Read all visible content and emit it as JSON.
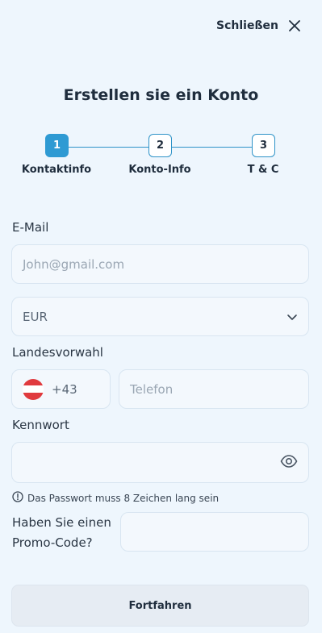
{
  "header": {
    "close_label": "Schließen"
  },
  "title": "Erstellen sie ein Konto",
  "stepper": {
    "steps": [
      {
        "number": "1",
        "label": "Kontaktinfo",
        "active": true
      },
      {
        "number": "2",
        "label": "Konto-Info",
        "active": false
      },
      {
        "number": "3",
        "label": "T & C",
        "active": false
      }
    ]
  },
  "form": {
    "email": {
      "label": "E-Mail",
      "placeholder": "John@gmail.com"
    },
    "currency": {
      "value": "EUR"
    },
    "phone": {
      "label": "Landesvorwahl",
      "country_code": "+43",
      "country_flag": "austria-flag",
      "placeholder": "Telefon"
    },
    "password": {
      "label": "Kennwort",
      "hint": "Das Passwort muss 8 Zeichen lang sein"
    },
    "promo": {
      "label": "Haben Sie einen Promo-Code?"
    }
  },
  "submit_label": "Fortfahren",
  "colors": {
    "accent": "#2e9ad3",
    "background": "#eef6fd",
    "flag_red": "#e03a3e"
  }
}
